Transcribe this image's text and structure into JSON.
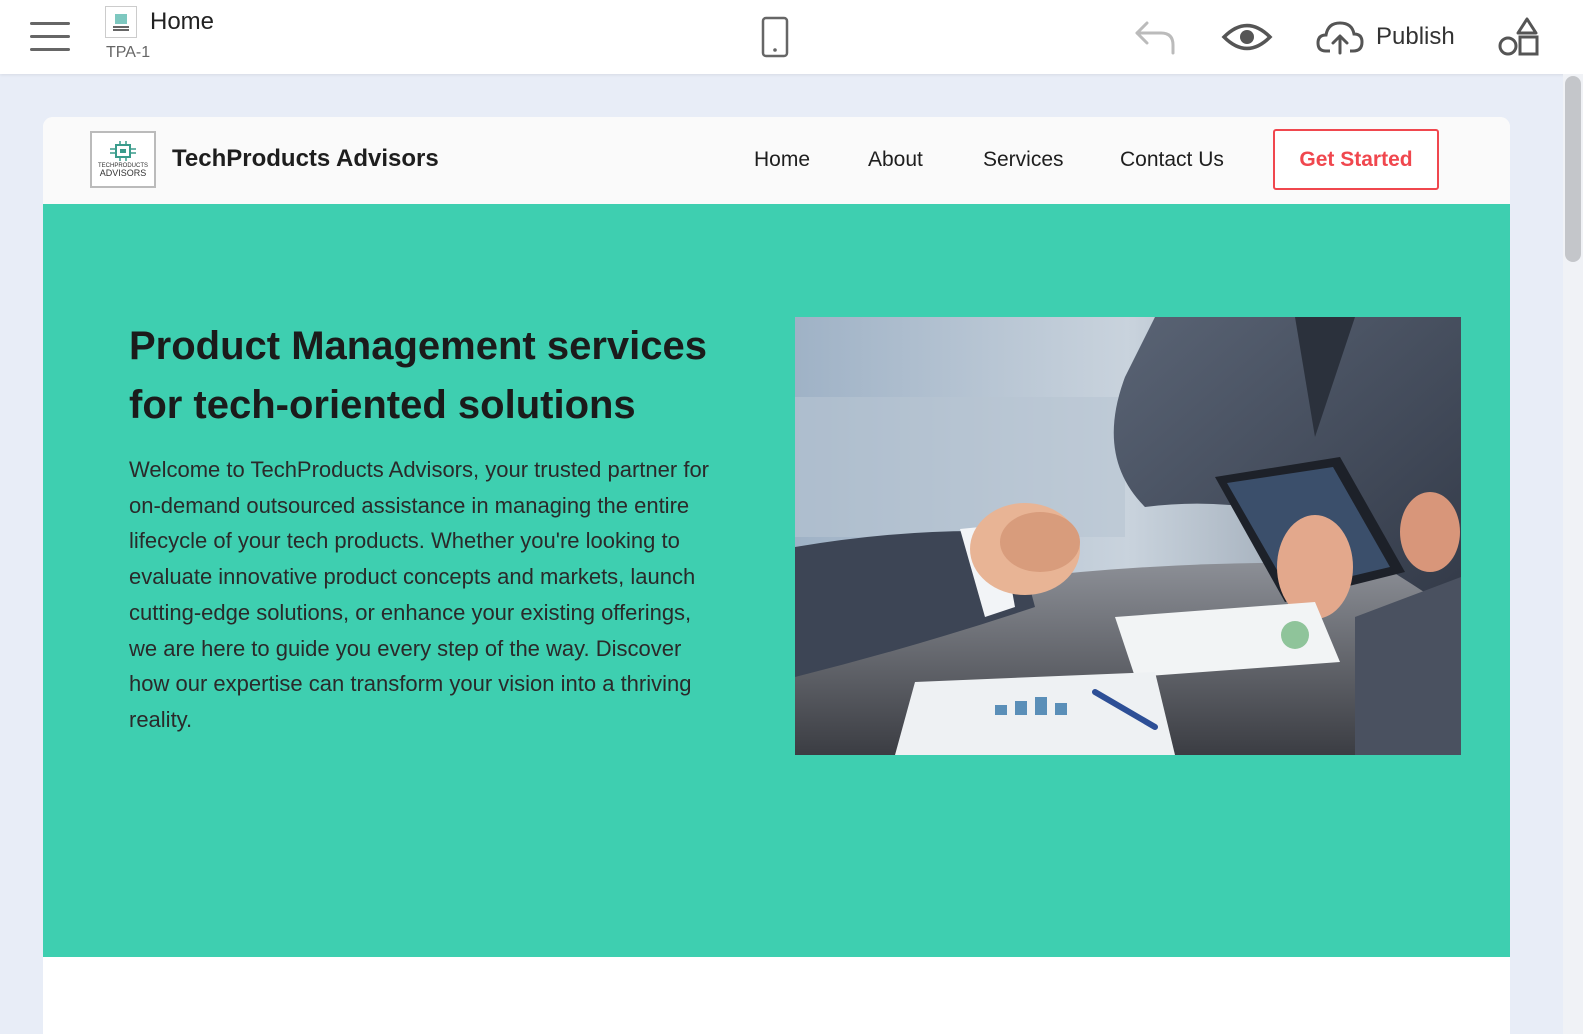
{
  "editor": {
    "page_name": "Home",
    "page_id": "TPA-1",
    "publish_label": "Publish",
    "icons": {
      "menu": "hamburger-icon",
      "device": "mobile-phone-icon",
      "undo": "undo-icon",
      "preview": "eye-icon",
      "publish": "cloud-upload-icon",
      "elements": "shapes-icon"
    }
  },
  "site": {
    "logo_text": [
      "TECHPRODUCTS",
      "ADVISORS"
    ],
    "brand": "TechProducts Advisors",
    "nav": [
      "Home",
      "About",
      "Services",
      "Contact Us"
    ],
    "cta": "Get Started",
    "hero": {
      "title": "Product Management services for tech-oriented solutions",
      "body": "Welcome to TechProducts Advisors, your trusted partner for on-demand outsourced assistance in managing the entire lifecycle of your tech products. Whether you're looking to evaluate innovative product concepts and markets, launch cutting-edge solutions, or enhance your existing offerings, we are here to guide you every step of the way. Discover how our expertise can transform your vision into a thriving reality."
    }
  },
  "colors": {
    "hero_bg": "#3ecfb0",
    "cta_accent": "#f0474e",
    "canvas_bg": "#e8edf7"
  }
}
